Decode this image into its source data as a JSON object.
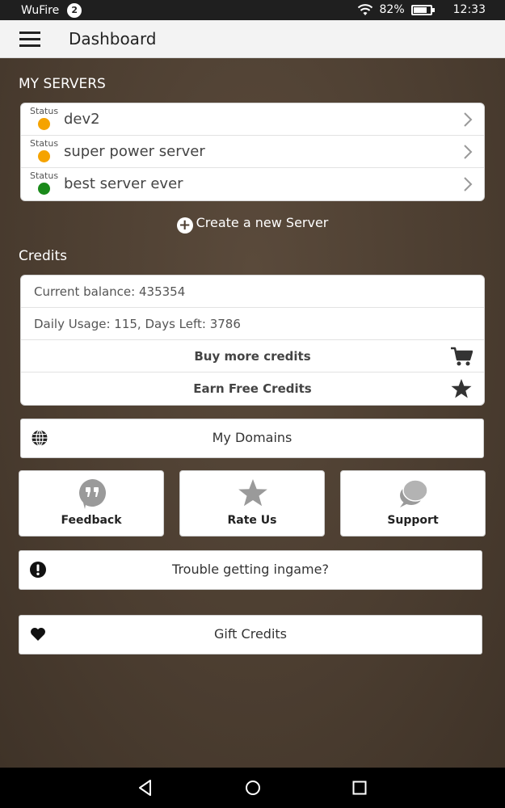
{
  "status_bar": {
    "carrier": "WuFire",
    "notification_count": "2",
    "battery": "82%",
    "battery_level": 0.82,
    "time": "12:33"
  },
  "app_bar": {
    "title": "Dashboard",
    "menu_icon": "hamburger-menu-icon"
  },
  "servers": {
    "heading": "MY SERVERS",
    "items": [
      {
        "status_label": "Status",
        "name": "dev2",
        "status_color": "#f5a300"
      },
      {
        "status_label": "Status",
        "name": "super power server",
        "status_color": "#f5a300"
      },
      {
        "status_label": "Status",
        "name": "best server ever",
        "status_color": "#1a8a1a"
      }
    ],
    "create_label": "Create a new Server"
  },
  "credits": {
    "heading": "Credits",
    "balance_text": "Current balance: 435354",
    "usage_text": "Daily Usage: 115, Days Left: 3786",
    "buy_label": "Buy more credits",
    "buy_icon": "shopping-cart-icon",
    "earn_label": "Earn Free Credits",
    "earn_icon": "star-icon"
  },
  "domains": {
    "label": "My Domains",
    "icon": "globe-icon"
  },
  "tiles": [
    {
      "label": "Feedback",
      "icon": "quote-bubble-icon"
    },
    {
      "label": "Rate Us",
      "icon": "star-icon"
    },
    {
      "label": "Support",
      "icon": "chat-bubbles-icon"
    }
  ],
  "trouble": {
    "label": "Trouble getting ingame?",
    "icon": "exclamation-icon"
  },
  "gift": {
    "label": "Gift Credits",
    "icon": "heart-icon"
  },
  "nav": {
    "back_icon": "back-triangle-icon",
    "home_icon": "home-circle-icon",
    "recents_icon": "recents-square-icon"
  }
}
